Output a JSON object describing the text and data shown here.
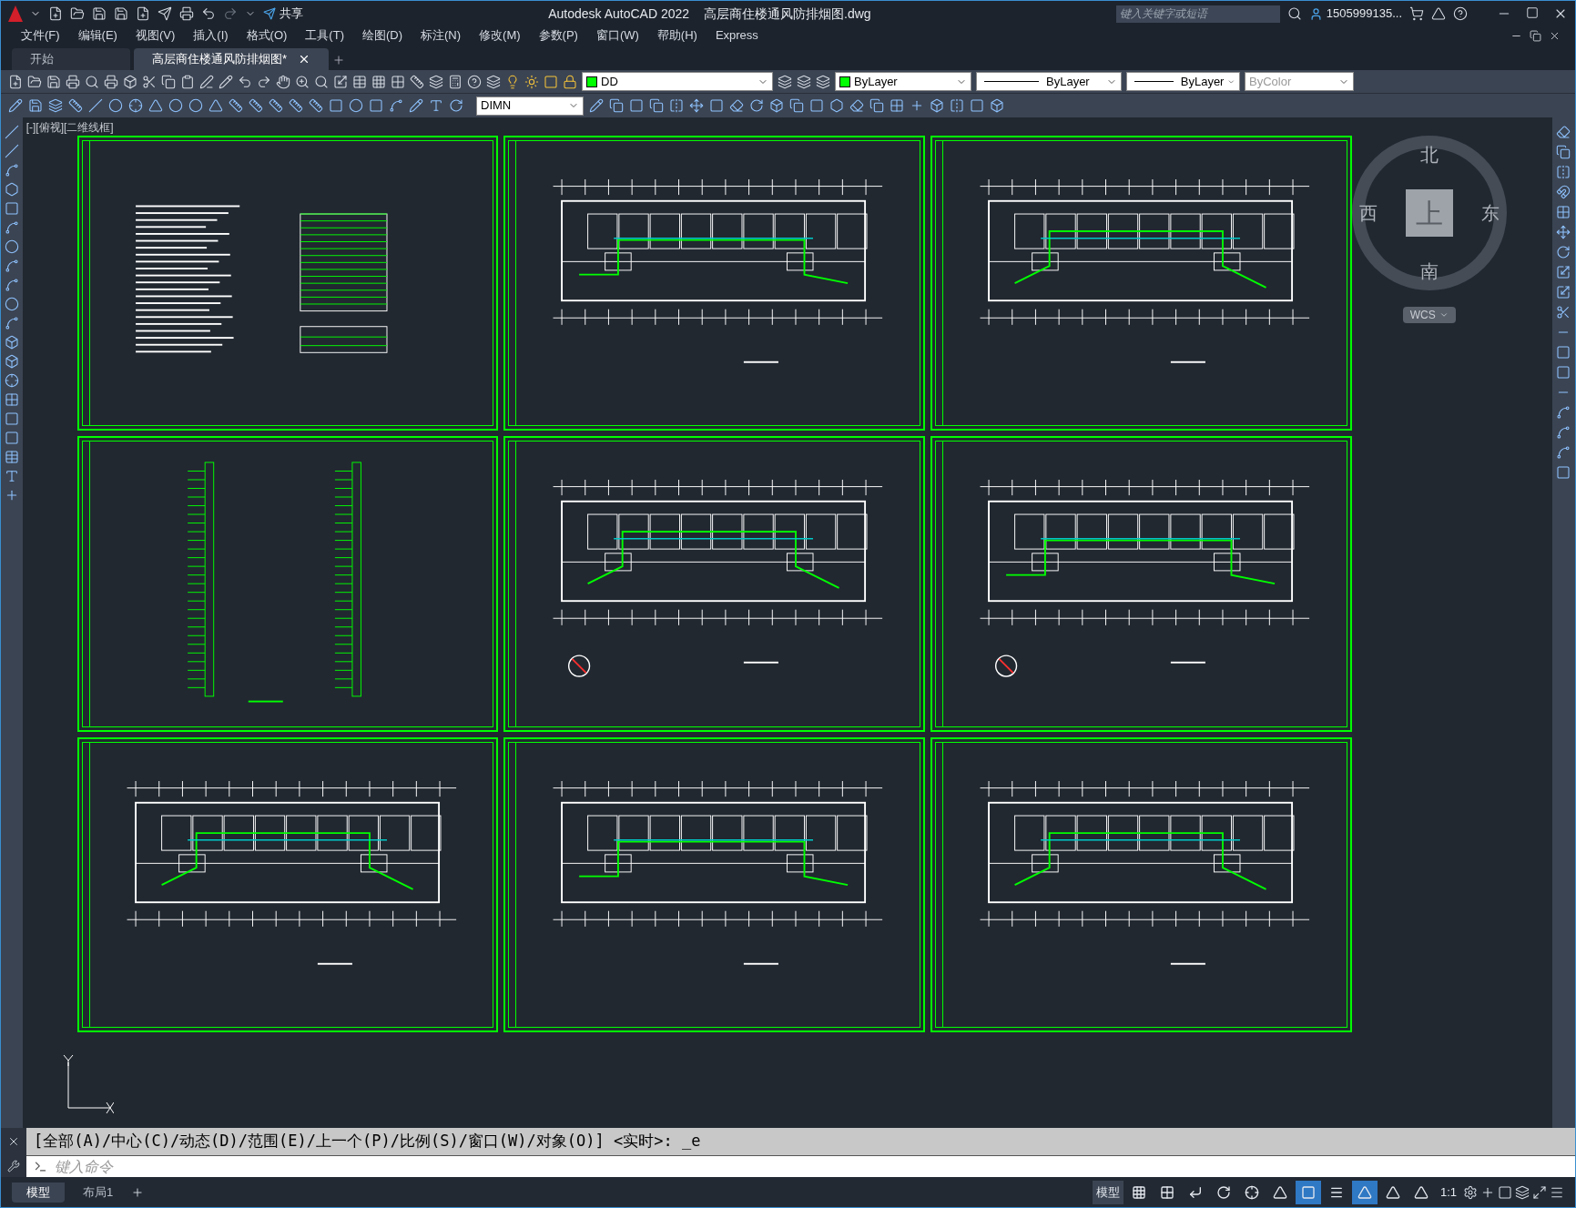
{
  "title_bar": {
    "app": "Autodesk AutoCAD 2022",
    "file": "高层商住楼通风防排烟图.dwg",
    "share": "共享",
    "search_placeholder": "键入关键字或短语",
    "user": "1505999135..."
  },
  "menu": [
    "文件(F)",
    "编辑(E)",
    "视图(V)",
    "插入(I)",
    "格式(O)",
    "工具(T)",
    "绘图(D)",
    "标注(N)",
    "修改(M)",
    "参数(P)",
    "窗口(W)",
    "帮助(H)",
    "Express"
  ],
  "tabs": [
    {
      "label": "开始",
      "selected": false
    },
    {
      "label": "高层商住楼通风防排烟图*",
      "selected": true
    }
  ],
  "properties": {
    "layer": "DD",
    "color_control": "ByLayer",
    "linetype": "ByLayer",
    "lineweight": "ByLayer",
    "plot_style": "ByColor",
    "plot_style_disabled": true,
    "dim_style": "DIMN"
  },
  "viewport_label": "[-][俯视][二维线框]",
  "viewcube": {
    "north": "北",
    "south": "南",
    "east": "东",
    "west": "西",
    "top": "上",
    "ucs": "WCS"
  },
  "sheets": [
    {
      "kind": "notes"
    },
    {
      "kind": "plan",
      "north_arrow": false
    },
    {
      "kind": "plan",
      "north_arrow": false
    },
    {
      "kind": "riser"
    },
    {
      "kind": "plan",
      "north_arrow": true
    },
    {
      "kind": "plan",
      "north_arrow": true
    },
    {
      "kind": "plan",
      "north_arrow": false
    },
    {
      "kind": "plan",
      "north_arrow": false
    },
    {
      "kind": "plan",
      "north_arrow": false
    }
  ],
  "command_history": "[全部(A)/中心(C)/动态(D)/范围(E)/上一个(P)/比例(S)/窗口(W)/对象(O)] <实时>: _e",
  "command_placeholder": "键入命令",
  "layout_tabs": [
    {
      "label": "模型",
      "selected": true
    },
    {
      "label": "布局1",
      "selected": false
    }
  ],
  "status_bar": {
    "space": "模型",
    "scale": "1:1",
    "toggles": [
      {
        "on": false
      },
      {
        "on": false
      },
      {
        "on": false
      },
      {
        "on": false
      },
      {
        "on": false
      },
      {
        "on": false
      },
      {
        "on": true
      },
      {
        "on": false
      },
      {
        "on": true
      },
      {
        "on": false
      },
      {
        "on": false
      }
    ]
  }
}
